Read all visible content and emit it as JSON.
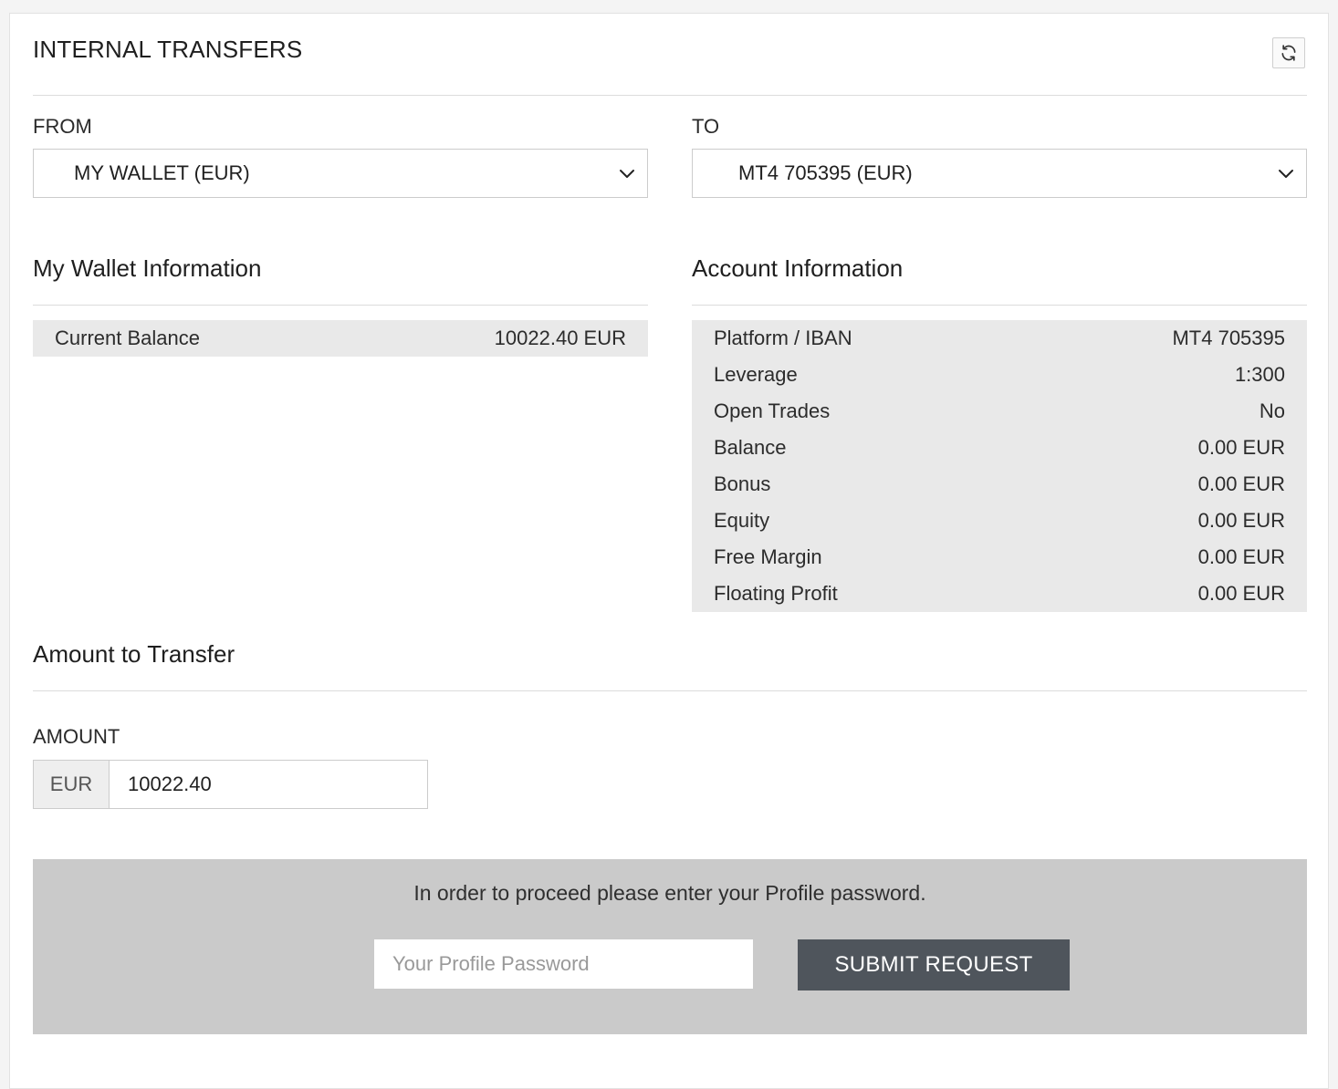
{
  "header": {
    "title": "INTERNAL TRANSFERS",
    "refresh_icon": "refresh-icon"
  },
  "from": {
    "label": "FROM",
    "selected": "MY WALLET (EUR)"
  },
  "to": {
    "label": "TO",
    "selected": "MT4 705395 (EUR)"
  },
  "wallet_info": {
    "title": "My Wallet Information",
    "rows": [
      {
        "label": "Current Balance",
        "value": "10022.40 EUR"
      }
    ]
  },
  "account_info": {
    "title": "Account Information",
    "rows": [
      {
        "label": "Platform / IBAN",
        "value": "MT4 705395"
      },
      {
        "label": "Leverage",
        "value": "1:300"
      },
      {
        "label": "Open Trades",
        "value": "No"
      },
      {
        "label": "Balance",
        "value": "0.00 EUR"
      },
      {
        "label": "Bonus",
        "value": "0.00 EUR"
      },
      {
        "label": "Equity",
        "value": "0.00 EUR"
      },
      {
        "label": "Free Margin",
        "value": "0.00 EUR"
      },
      {
        "label": "Floating Profit",
        "value": "0.00 EUR"
      }
    ]
  },
  "amount_section": {
    "title": "Amount to Transfer",
    "label": "AMOUNT",
    "currency": "EUR",
    "value": "10022.40"
  },
  "confirm": {
    "message": "In order to proceed please enter your Profile password.",
    "password_placeholder": "Your Profile Password",
    "submit_label": "SUBMIT REQUEST"
  },
  "colors": {
    "info_bg": "#e9e9e9",
    "confirm_bg": "#cacaca",
    "submit_bg": "#4f555c"
  }
}
